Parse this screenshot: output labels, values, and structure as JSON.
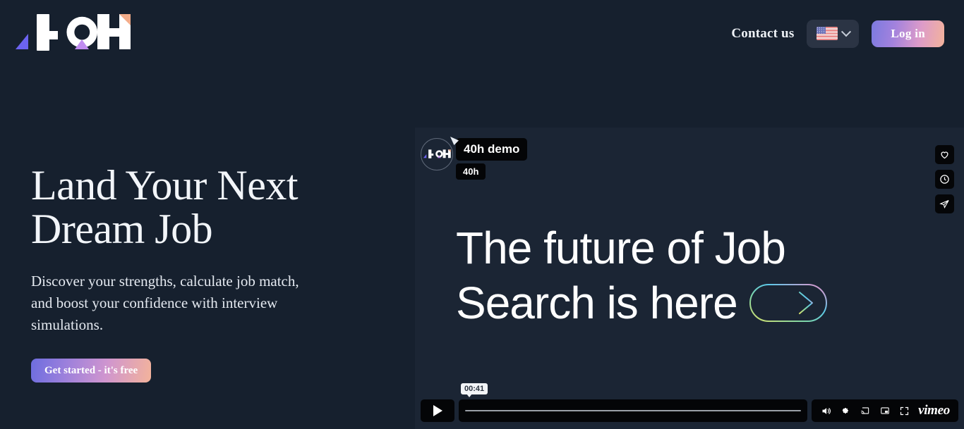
{
  "brand": {
    "logo_text": "40h"
  },
  "header": {
    "contact_label": "Contact us",
    "language": {
      "flag": "us-flag-icon",
      "chevron": "chevron-down-icon"
    },
    "login_label": "Log in"
  },
  "hero": {
    "title_line1": "Land Your Next",
    "title_line2": "Dream Job",
    "description": "Discover your strengths, calculate job match, and boost your confidence with interview simulations.",
    "cta_label": "Get started - it's free"
  },
  "video": {
    "avatar": "40h-logo-avatar",
    "title": "40h demo",
    "author": "40h",
    "actions": [
      {
        "name": "like-icon"
      },
      {
        "name": "watch-later-icon"
      },
      {
        "name": "share-icon"
      }
    ],
    "headline_line1": "The future  of Job",
    "headline_line2": "Search is here",
    "arrow": "arrow-right-icon",
    "controls": {
      "play": "play-icon",
      "time": "00:41",
      "volume": "volume-icon",
      "settings": "gear-icon",
      "chromecast": "chromecast-icon",
      "picture_in_picture": "picture-in-picture-icon",
      "fullscreen": "fullscreen-icon",
      "brand": "vimeo"
    }
  },
  "colors": {
    "background": "#16202e",
    "video_background": "#1b2534",
    "gradient_start": "#7b7ae0",
    "gradient_mid": "#dd9bc9",
    "gradient_end": "#f3b39b",
    "logo_blue": "#6c63f0",
    "logo_purple": "#c08cf0",
    "logo_peach": "#f2ac8a"
  }
}
